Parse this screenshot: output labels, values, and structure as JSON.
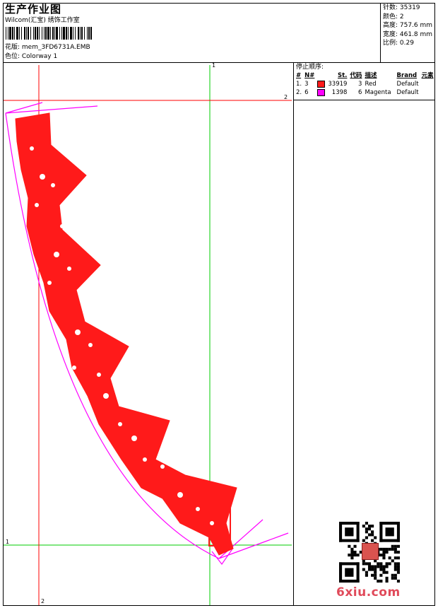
{
  "header": {
    "title": "生产作业图",
    "company": "Wilcom(汇宝) 绣饰工作室",
    "design_file": "花版: mem_3FD6731A.EMB",
    "colorway": "色位: Colorway 1"
  },
  "stats": {
    "stitches": "针数: 35319",
    "colors": "颜色: 2",
    "height": "高度: 757.6 mm",
    "width": "宽度: 461.8 mm",
    "scale": "比例: 0.29"
  },
  "legend": {
    "heading": "停止顺序:",
    "columns": [
      "#",
      "N#",
      "St.",
      "代码",
      "描述",
      "Brand",
      "元素"
    ],
    "rows": [
      {
        "index": "1.",
        "needle": "3",
        "color": "#ff1a1a",
        "stitches": "33919",
        "code": "3",
        "description": "Red",
        "brand": "Default"
      },
      {
        "index": "2.",
        "needle": "6",
        "color": "#ff00ff",
        "stitches": "1398",
        "code": "6",
        "description": "Magenta",
        "brand": "Default"
      }
    ]
  },
  "axes": {
    "top_marker": "1",
    "right_marker": "2",
    "left_marker": "1",
    "bottom_marker": "2"
  },
  "colors": {
    "stitch_red": "#ff1a1a",
    "outline_magenta": "#ff00ff",
    "guide_green": "#00cc00",
    "guide_red": "#ff0000"
  },
  "watermark": "6xiu.com"
}
